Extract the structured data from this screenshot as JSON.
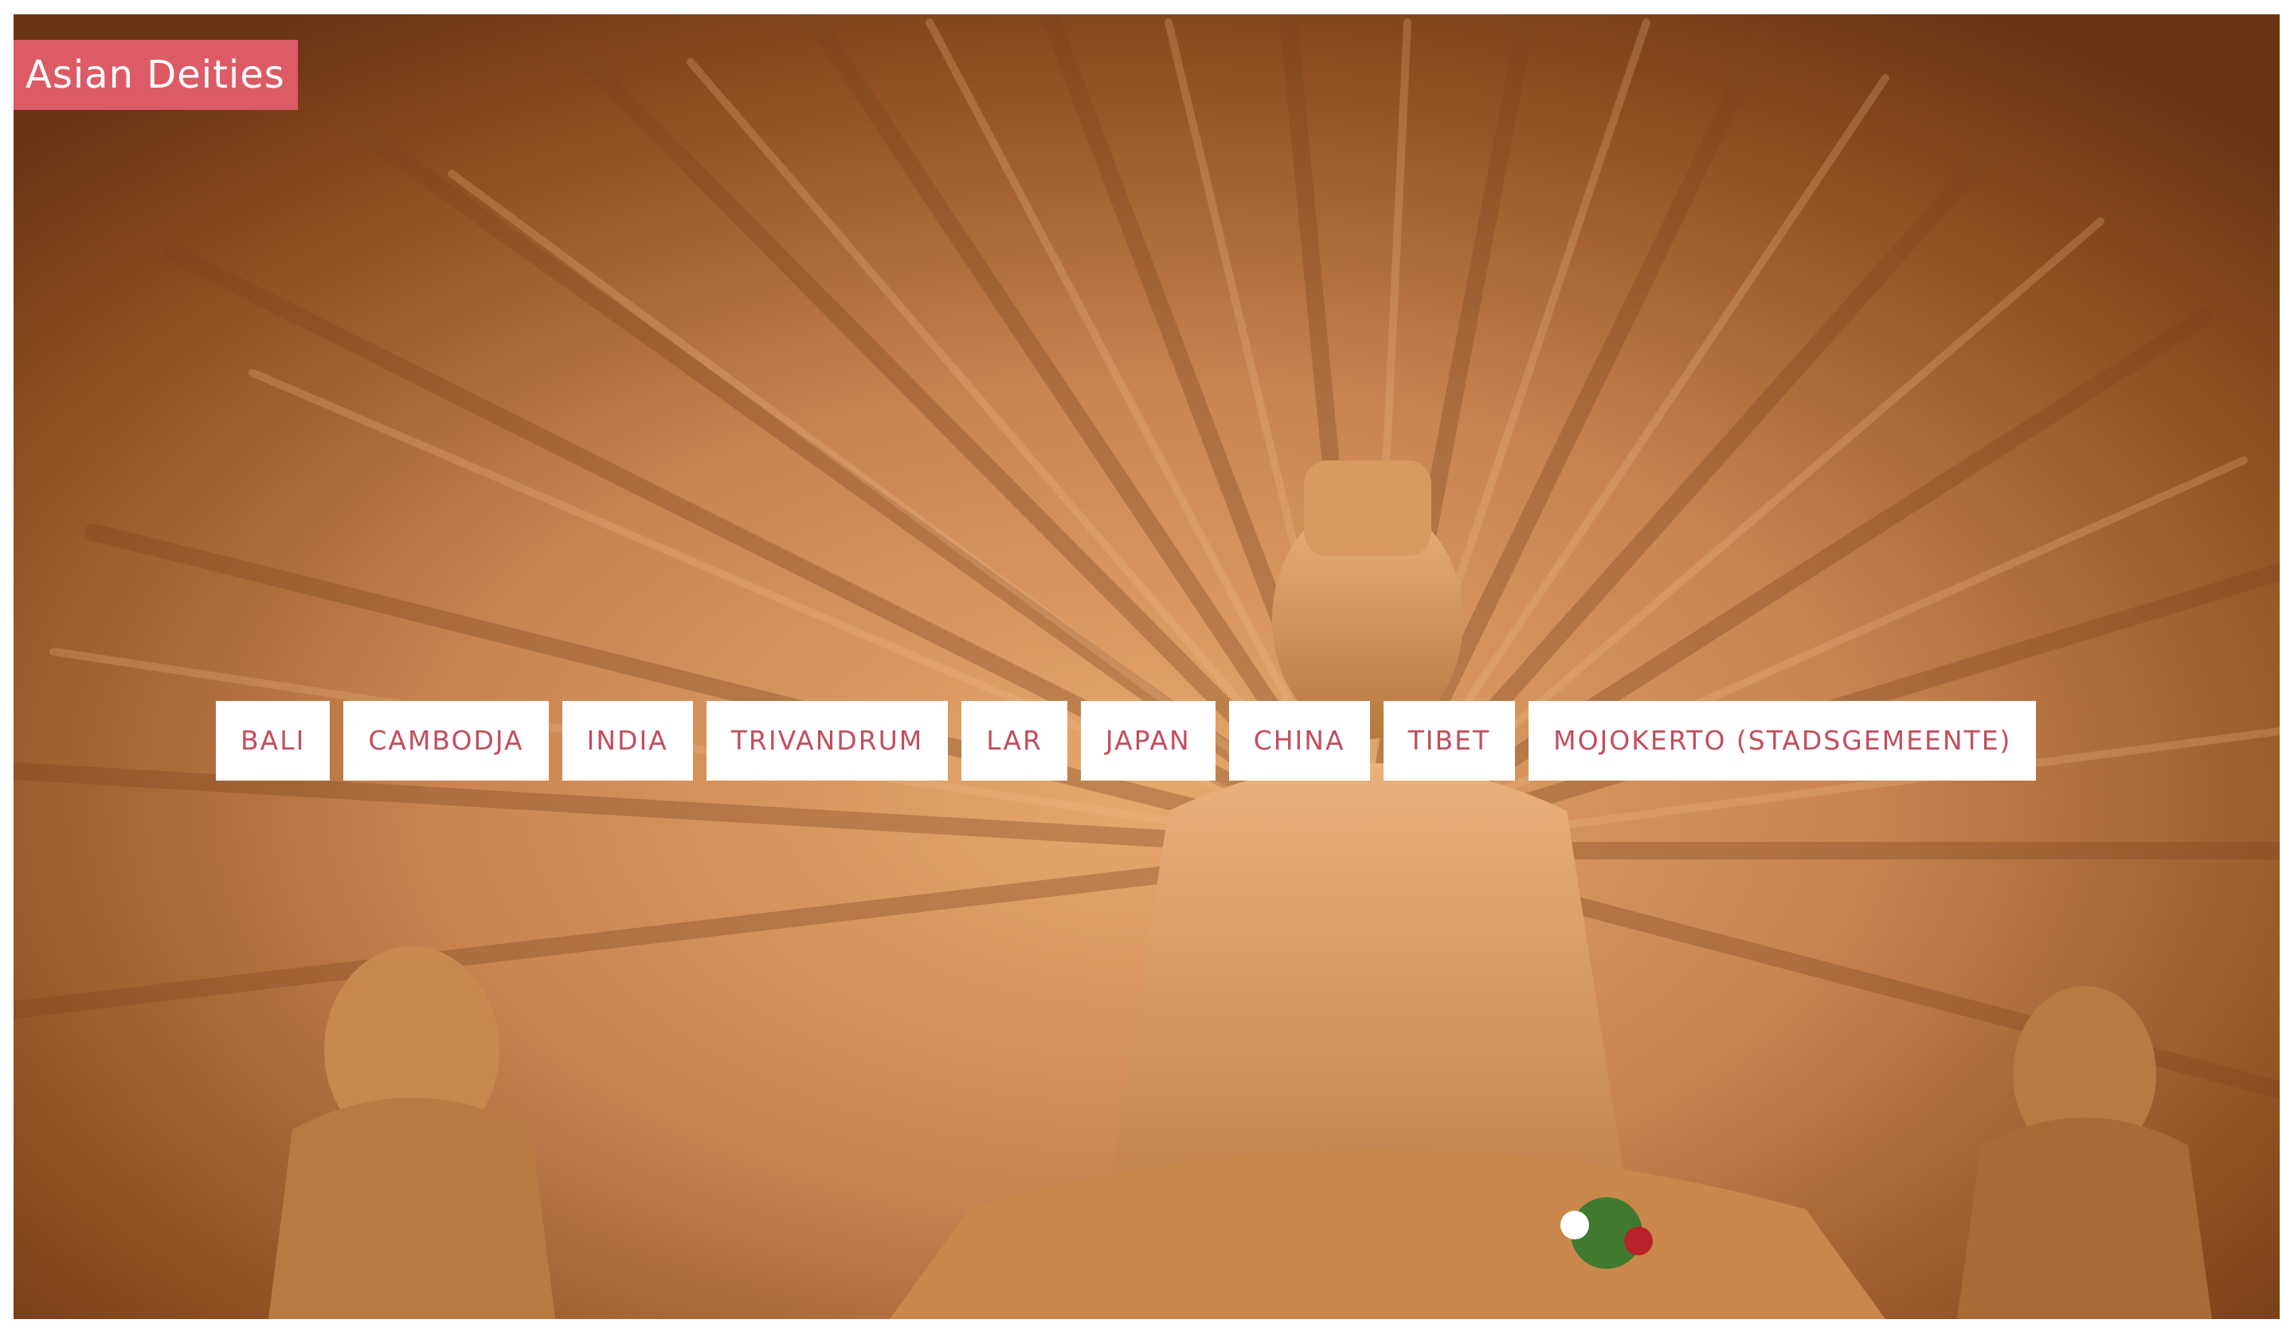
{
  "site": {
    "title": "Asian Deities"
  },
  "hero": {
    "image_subject": "thousand-armed-deity-sculpture"
  },
  "nav": {
    "items": [
      {
        "label": "BALI"
      },
      {
        "label": "CAMBODJA"
      },
      {
        "label": "INDIA"
      },
      {
        "label": "TRIVANDRUM"
      },
      {
        "label": "LAR"
      },
      {
        "label": "JAPAN"
      },
      {
        "label": "CHINA"
      },
      {
        "label": "TIBET"
      },
      {
        "label": "MOJOKERTO (STADSGEMEENTE)"
      }
    ]
  },
  "colors": {
    "accent": "#dc5b66",
    "nav_text": "#c24e5d",
    "nav_bg": "#ffffff",
    "background": "#ffffff"
  }
}
